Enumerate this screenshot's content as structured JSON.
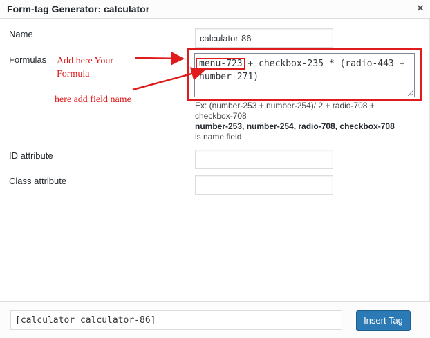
{
  "dialog": {
    "title": "Form-tag Generator: calculator",
    "close_symbol": "×"
  },
  "fields": {
    "name_label": "Name",
    "name_value": "calculator-86",
    "formulas_label": "Formulas",
    "formula_value": "menu-723 + checkbox-235 * (radio-443 +\nnumber-271)",
    "help_example": "Ex: (number-253 + number-254)/ 2 + radio-708 + checkbox-708",
    "help_fields": "number-253, number-254, radio-708, checkbox-708",
    "help_suffix": " is name field",
    "id_label": "ID attribute",
    "id_value": "",
    "class_label": "Class attribute",
    "class_value": ""
  },
  "annotations": {
    "formula_note_line1": "Add here Your",
    "formula_note_line2": "Formula",
    "field_note": "here add field name",
    "color": "#e01b1b"
  },
  "footer": {
    "shortcode": "[calculator calculator-86]",
    "insert_label": "Insert Tag"
  }
}
